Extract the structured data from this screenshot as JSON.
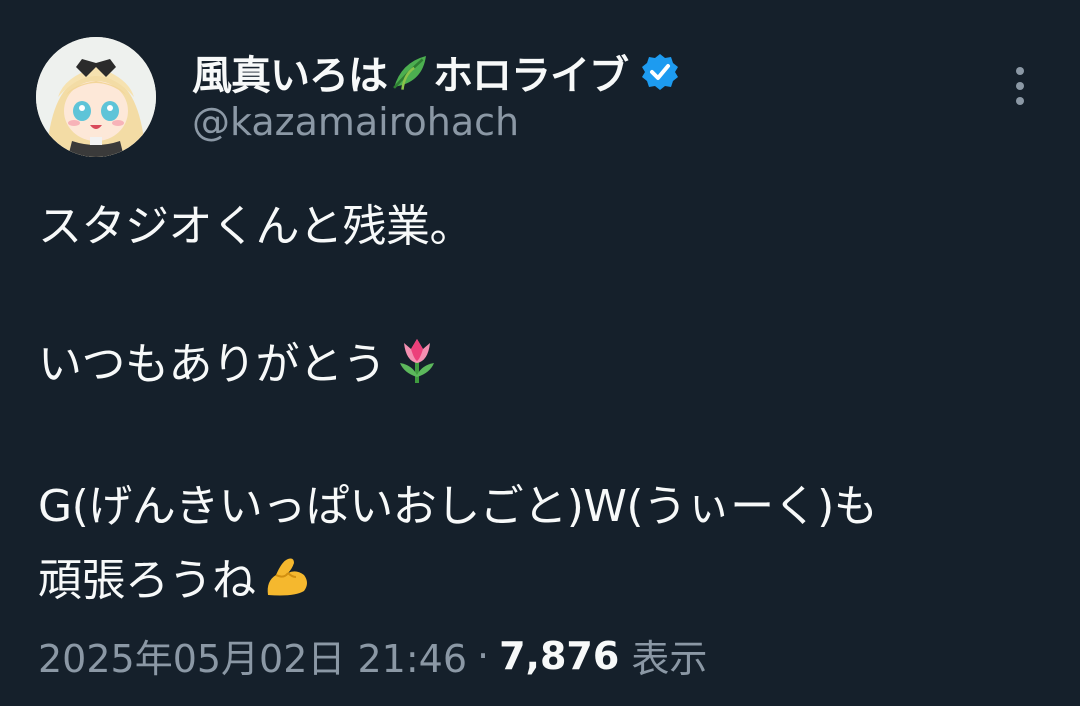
{
  "author": {
    "display_name": "風真いろは",
    "display_name_suffix": "ホロライブ",
    "leaf_emoji": "leaf-emoji",
    "handle": "@kazamairohach",
    "verified_color": "#1d9bf0",
    "verified_icon": "verified-badge-icon"
  },
  "tweet": {
    "line1": "スタジオくんと残業。",
    "line2": "いつもありがとう",
    "line2_emoji": "tulip-emoji",
    "line3": "G(げんきいっぱいおしごと)W(うぃーく)も",
    "line4": "頑張ろうね",
    "line4_emoji": "flexed-biceps-emoji"
  },
  "meta": {
    "datetime": "2025年05月02日 21:46",
    "separator": "·",
    "views_count": "7,876",
    "views_label": "表示"
  },
  "menu": {
    "icon": "more-options-icon"
  },
  "colors": {
    "background": "#15202b",
    "primary_text": "#f7f9f9",
    "secondary_text": "#8b98a5"
  }
}
